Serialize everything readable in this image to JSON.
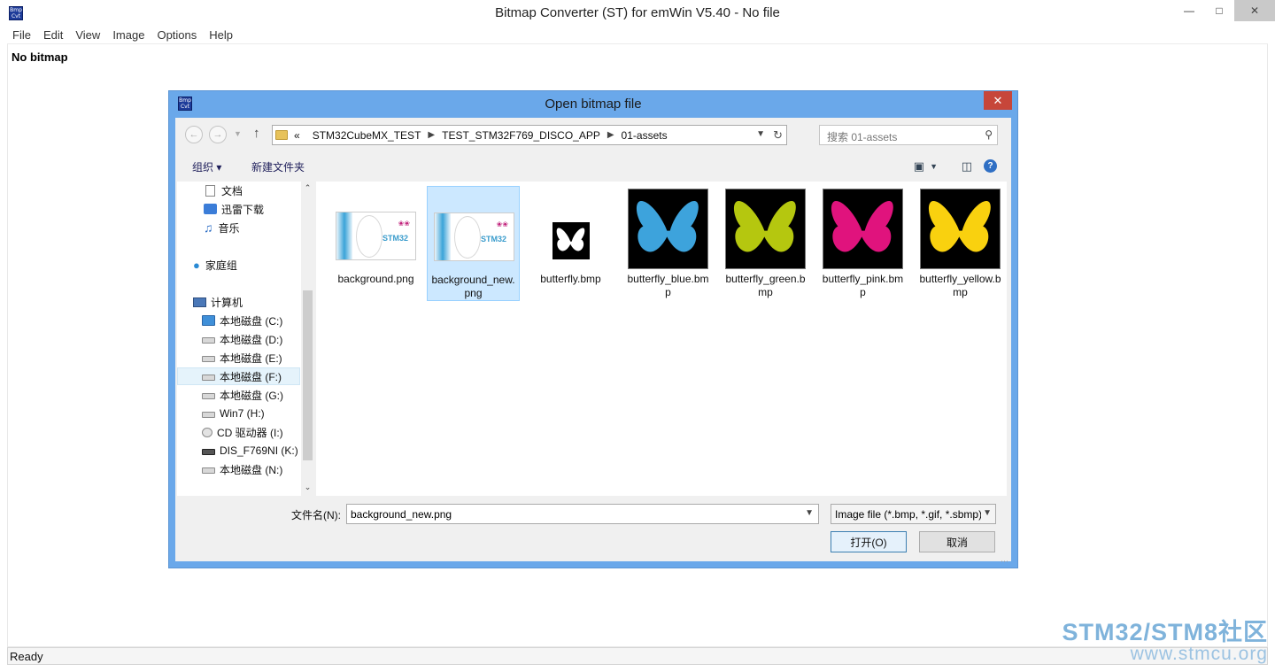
{
  "app": {
    "title": "Bitmap Converter (ST) for emWin V5.40 - No file",
    "icon_text": "Bmp Cvt"
  },
  "menu": [
    "File",
    "Edit",
    "View",
    "Image",
    "Options",
    "Help"
  ],
  "content": {
    "no_bitmap": "No bitmap"
  },
  "status": {
    "text": "Ready"
  },
  "watermark": {
    "line1": "STM32/STM8社区",
    "line2": "www.stmcu.org"
  },
  "dialog": {
    "title": "Open bitmap file",
    "breadcrumb": {
      "prefix": "«",
      "parts": [
        "STM32CubeMX_TEST",
        "TEST_STM32F769_DISCO_APP",
        "01-assets"
      ]
    },
    "search_placeholder": "搜索 01-assets",
    "toolbar": {
      "organize": "组织 ▾",
      "new_folder": "新建文件夹"
    },
    "nav_items": [
      {
        "label": "文档",
        "icon": "document-icon"
      },
      {
        "label": "迅雷下载",
        "icon": "download-icon"
      },
      {
        "label": "音乐",
        "icon": "music-icon"
      },
      {
        "label": "家庭组",
        "icon": "homegroup-icon"
      },
      {
        "label": "计算机",
        "icon": "computer-icon"
      },
      {
        "label": "本地磁盘 (C:)",
        "icon": "windows-drive-icon"
      },
      {
        "label": "本地磁盘 (D:)",
        "icon": "drive-icon"
      },
      {
        "label": "本地磁盘 (E:)",
        "icon": "drive-icon"
      },
      {
        "label": "本地磁盘 (F:)",
        "icon": "drive-icon",
        "selected": true
      },
      {
        "label": "本地磁盘 (G:)",
        "icon": "drive-icon"
      },
      {
        "label": "Win7 (H:)",
        "icon": "drive-icon"
      },
      {
        "label": "CD 驱动器 (I:)",
        "icon": "cd-drive-icon"
      },
      {
        "label": "DIS_F769NI (K:)",
        "icon": "usb-drive-icon"
      },
      {
        "label": "本地磁盘 (N:)",
        "icon": "drive-icon"
      }
    ],
    "files": [
      {
        "name": "background.png",
        "thumb": "background"
      },
      {
        "name": "background_new.png",
        "thumb": "background",
        "selected": true
      },
      {
        "name": "butterfly.bmp",
        "thumb": "white-mask",
        "color": "#ffffff"
      },
      {
        "name": "butterfly_blue.bmp",
        "thumb": "butterfly",
        "color": "#3da3dc"
      },
      {
        "name": "butterfly_green.bmp",
        "thumb": "butterfly",
        "color": "#b5c70f"
      },
      {
        "name": "butterfly_pink.bmp",
        "thumb": "butterfly",
        "color": "#e0137d"
      },
      {
        "name": "butterfly_yellow.bmp",
        "thumb": "butterfly",
        "color": "#f9d10f"
      }
    ],
    "thumb_logo": "STM32",
    "filename_label": "文件名(N):",
    "filename_value": "background_new.png",
    "filetype": "Image file (*.bmp, *.gif, *.sbmp)",
    "open_button": "打开(O)",
    "cancel_button": "取消"
  }
}
